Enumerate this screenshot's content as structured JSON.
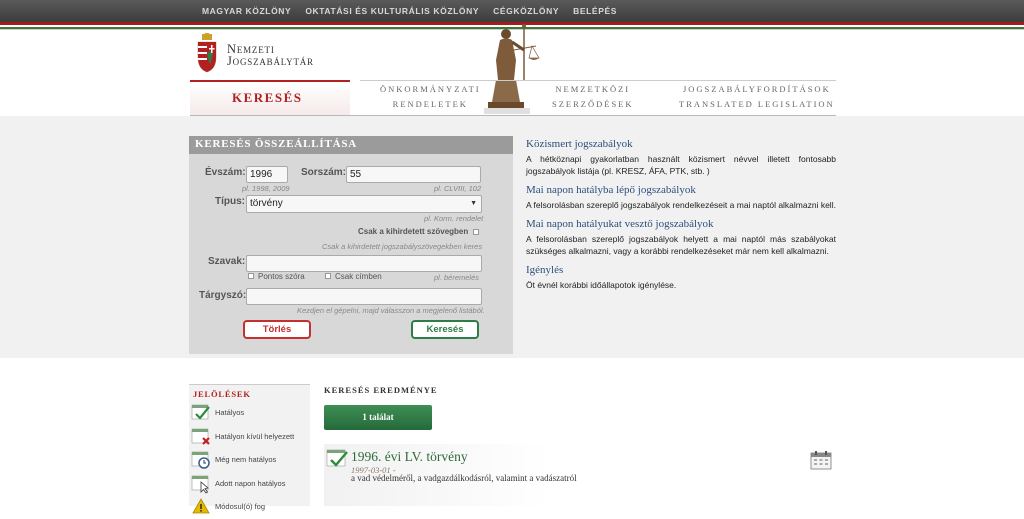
{
  "topnav": [
    "MAGYAR KÖZLÖNY",
    "OKTATÁSI ÉS KULTURÁLIS KÖZLÖNY",
    "CÉGKÖZLÖNY",
    "BELÉPÉS"
  ],
  "logo": {
    "line1": "Nemzeti",
    "line2": "Jogszabálytár"
  },
  "tabs": {
    "active": "KERESÉS",
    "t1": [
      "ÖNKORMÁNYZATI",
      "RENDELETEK"
    ],
    "t2": [
      "NEMZETKÖZI",
      "SZERZŐDÉSEK"
    ],
    "t3": [
      "JOGSZABÁLYFORDÍTÁSOK",
      "TRANSLATED LEGISLATION"
    ]
  },
  "search": {
    "header": "KERESÉS ÖSSZEÁLLÍTÁSA",
    "year_label": "Évszám:",
    "year_value": "1996",
    "year_hint": "pl. 1998, 2009",
    "number_label": "Sorszám:",
    "number_value": "55",
    "number_hint": "pl. CLVIII, 102",
    "type_label": "Típus:",
    "type_value": "törvény",
    "type_hint": "pl. Korm. rendelet",
    "only_promulgated_label": "Csak a kihirdetett szövegben",
    "only_promulgated_hint": "Csak a kihirdetett jogszabályszövegekben keres",
    "words_label": "Szavak:",
    "exact_label": "Pontos szóra",
    "title_only_label": "Csak címben",
    "words_hint": "pl. béremelés",
    "subject_label": "Tárgyszó:",
    "subject_hint": "Kezdjen el gépelni, majd válasszon a megjelenő listából.",
    "clear_button": "Törlés",
    "search_button": "Keresés"
  },
  "info": [
    {
      "heading": "Közismert jogszabályok",
      "text": "A hétköznapi gyakorlatban használt közismert névvel illetett fontosabb jogszabályok listája (pl. KRESZ, ÁFA, PTK, stb. )"
    },
    {
      "heading": "Mai napon hatályba lépő jogszabályok",
      "text": "A felsorolásban szereplő jogszabályok rendelkezéseit a mai naptól alkalmazni kell."
    },
    {
      "heading": "Mai napon hatályukat vesztő jogszabályok",
      "text": "A felsorolásban szereplő jogszabályok helyett a mai naptól más szabályokat szükséges alkalmazni, vagy a korábbi rendelkezéseket már nem kell alkalmazni."
    },
    {
      "heading": "Igénylés",
      "text": "Öt évnél korábbi időállapotok igénylése."
    }
  ],
  "legend": {
    "title": "JELÖLÉSEK",
    "items": [
      "Hatályos",
      "Hatályon kívül helyezett",
      "Még nem hatályos",
      "Adott napon hatályos",
      "Módosul(ó) fog"
    ]
  },
  "results": {
    "title": "KERESÉS EREDMÉNYE",
    "count": "1 találat",
    "item": {
      "title": "1996. évi LV. törvény",
      "date": "1997-03-01 -",
      "desc": "a vad védelméről, a vadgazdálkodásról, valamint a vadászatról"
    }
  },
  "colors": {
    "accent_red": "#b32020",
    "accent_green": "#2e7d46",
    "link_blue": "#2b4f7d"
  }
}
